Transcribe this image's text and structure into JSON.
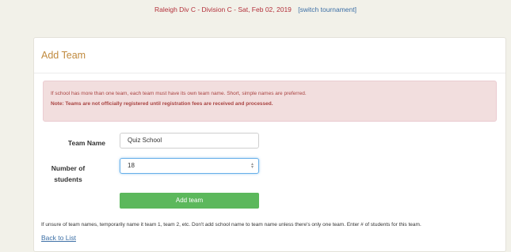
{
  "header": {
    "tournament": "Raleigh Div C - Division C - Sat, Feb 02, 2019",
    "switch_link": "[switch tournament]"
  },
  "panel": {
    "title": "Add Team"
  },
  "alert": {
    "info": "If school has more than one team, each team must have its own team name. Short, simple names are preferred.",
    "note": "Note: Teams are not officially registered until registration fees are received and processed."
  },
  "form": {
    "team_name_label": "Team Name",
    "team_name_value": "Quiz School",
    "num_students_label_1": "Number of",
    "num_students_label_2": "students",
    "num_students_value": "18",
    "submit_label": "Add team"
  },
  "footer": {
    "note": "If unsure of team names, temporarily name it team 1, team 2, etc. Don't add school name to team name unless there's only one team. Enter # of students for this team.",
    "back_link": "Back to List"
  }
}
